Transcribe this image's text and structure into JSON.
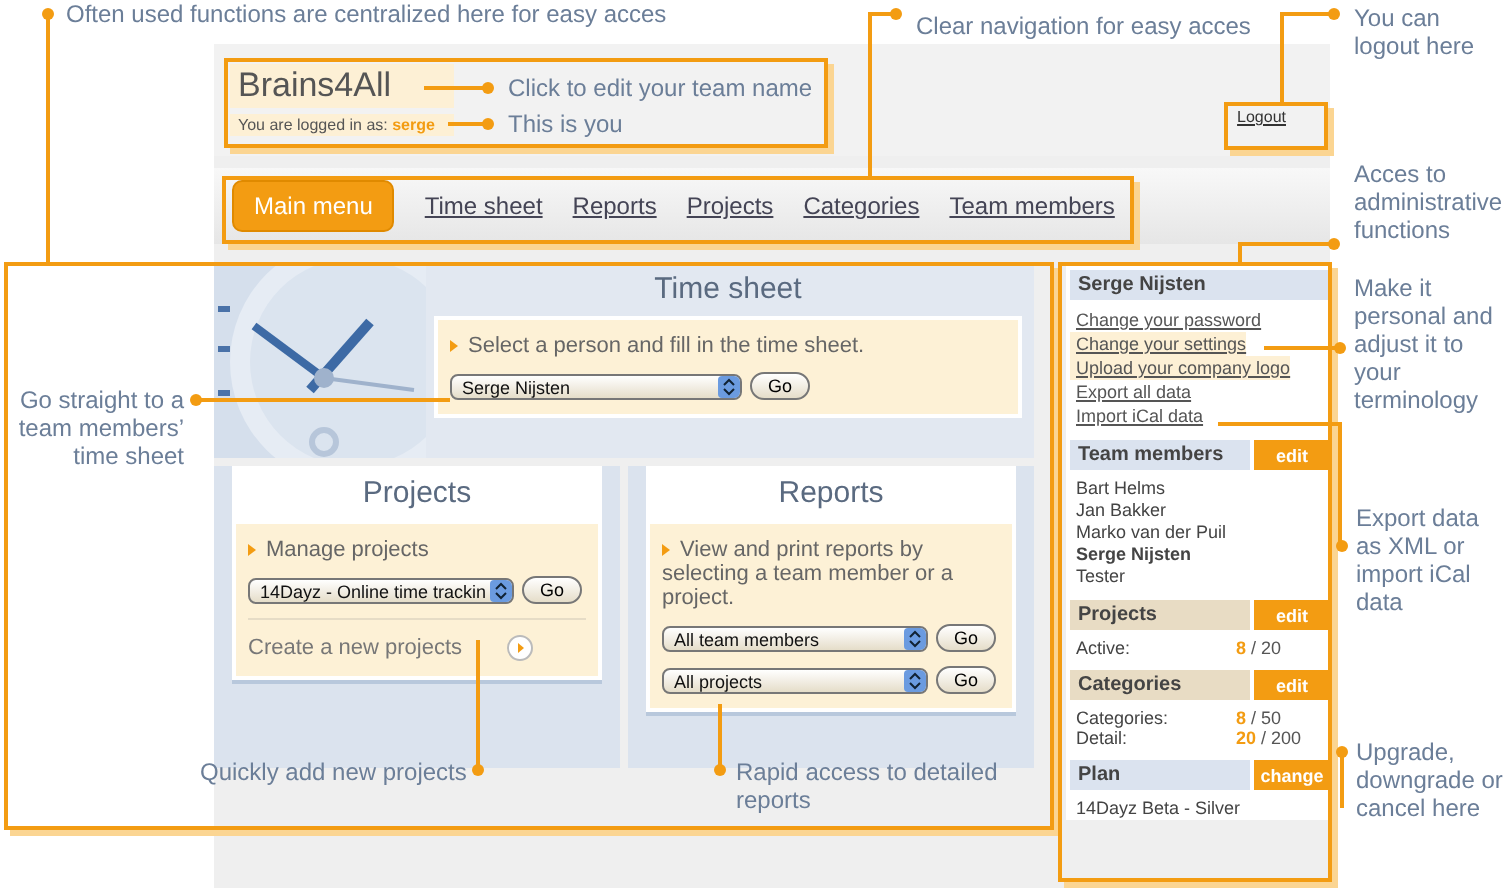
{
  "annotations": [
    {
      "text": "Often used functions are centralized here for easy acces"
    },
    {
      "text": "Click to edit your team name"
    },
    {
      "text": "This is you"
    },
    {
      "text": "Clear navigation for easy acces"
    },
    {
      "text": "You can logout here"
    },
    {
      "text": "Acces to administrative functions"
    },
    {
      "text": "Go straight to a team members’ time sheet"
    },
    {
      "text": "Make it personal and adjust it to your terminology"
    },
    {
      "text": "Export data as XML or import iCal data"
    },
    {
      "text": "Quickly add new projects"
    },
    {
      "text": "Rapid access to detailed reports"
    },
    {
      "text": "Upgrade, downgrade or cancel here"
    }
  ],
  "header": {
    "team_name": "Brains4All",
    "logged_in_label": "You are logged in as:",
    "user": "serge",
    "logout": "Logout"
  },
  "nav": [
    {
      "label": "Main menu",
      "selected": true
    },
    {
      "label": "Time sheet",
      "selected": false
    },
    {
      "label": "Reports",
      "selected": false
    },
    {
      "label": "Projects",
      "selected": false
    },
    {
      "label": "Categories",
      "selected": false
    },
    {
      "label": "Team members",
      "selected": false
    }
  ],
  "timesheet": {
    "title": "Time sheet",
    "instruction": "Select a person and fill in the time sheet.",
    "select": "Serge Nijsten",
    "button": "Go"
  },
  "projects": {
    "title": "Projects",
    "link": "Manage projects",
    "select": "14Dayz - Online time trackin",
    "button": "Go",
    "create": "Create a new projects"
  },
  "reports": {
    "title": "Reports",
    "text": "View and print reports by selecting a team member or a project.",
    "filters": [
      {
        "select": "All team members",
        "button": "Go"
      },
      {
        "select": "All projects",
        "button": "Go"
      }
    ]
  },
  "sidebar": {
    "user": "Serge Nijsten",
    "links": [
      {
        "label": "Change your password",
        "highlighted": false
      },
      {
        "label": "Change your settings",
        "highlighted": true
      },
      {
        "label": "Upload your company logo",
        "highlighted": true
      },
      {
        "label": "Export all data",
        "highlighted": false
      },
      {
        "label": "Import iCal data",
        "highlighted": false
      }
    ],
    "sections": [
      {
        "kind": "members",
        "title": "Team members",
        "action": "edit",
        "highlighted": false,
        "members": [
          {
            "name": "Bart Helms",
            "current": false
          },
          {
            "name": "Jan Bakker",
            "current": false
          },
          {
            "name": "Marko van der Puil",
            "current": false
          },
          {
            "name": "Serge Nijsten",
            "current": true
          },
          {
            "name": "Tester",
            "current": false
          }
        ]
      },
      {
        "kind": "stats",
        "title": "Projects",
        "action": "edit",
        "highlighted": true,
        "stats": [
          {
            "label": "Active:",
            "value": "8",
            "total": "/ 20"
          }
        ]
      },
      {
        "kind": "stats",
        "title": "Categories",
        "action": "edit",
        "highlighted": true,
        "stats": [
          {
            "label": "Categories:",
            "value": "8",
            "total": "/ 50"
          },
          {
            "label": "Detail:",
            "value": "20",
            "total": "/ 200"
          }
        ]
      },
      {
        "kind": "plan",
        "title": "Plan",
        "action": "change",
        "highlighted": false,
        "plan": "14Dayz Beta - Silver"
      }
    ]
  }
}
